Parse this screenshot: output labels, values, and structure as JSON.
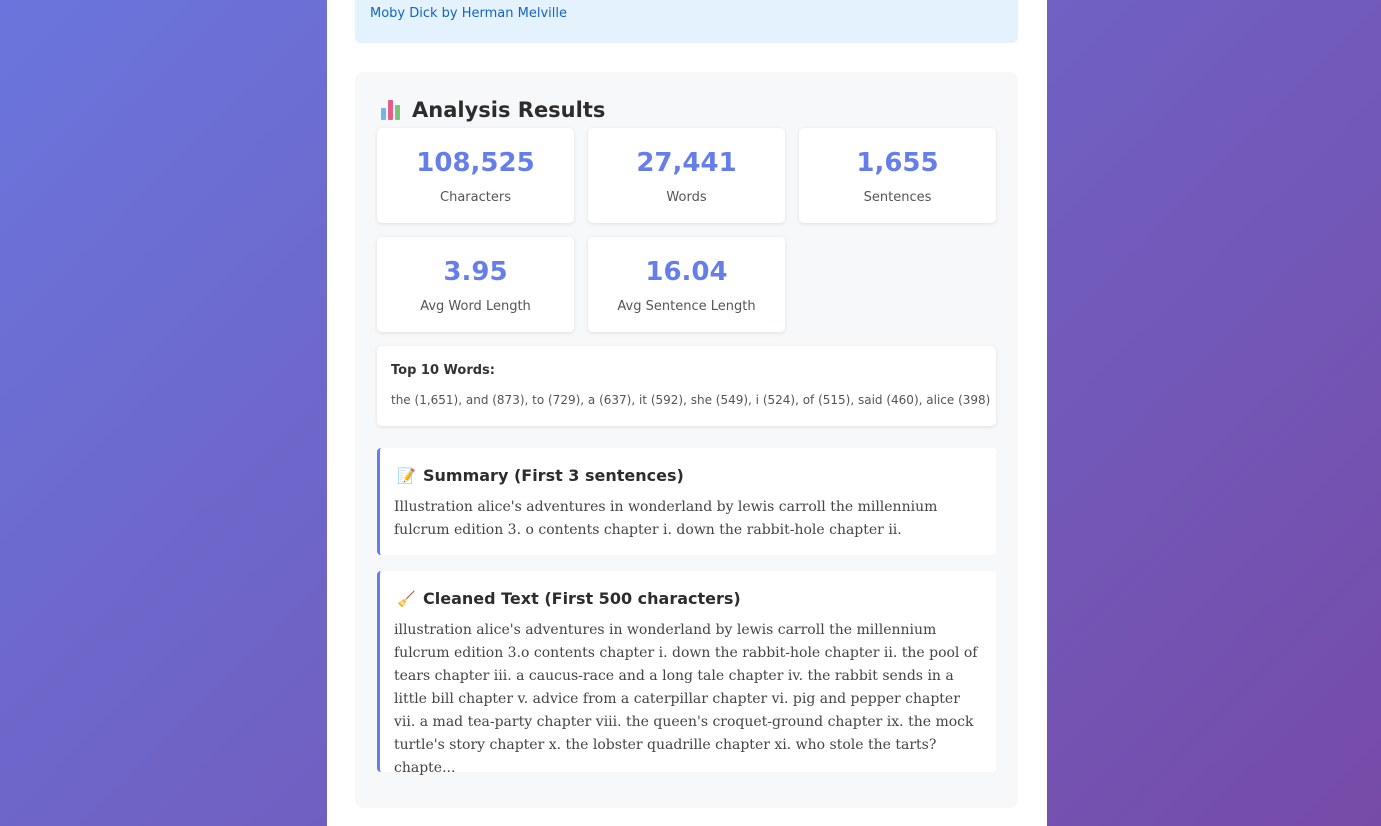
{
  "source": {
    "link_text": "Moby Dick by Herman Melville"
  },
  "results": {
    "title": "Analysis Results",
    "title_icon": "bar-chart-icon",
    "stats": [
      {
        "value": "108,525",
        "label": "Characters"
      },
      {
        "value": "27,441",
        "label": "Words"
      },
      {
        "value": "1,655",
        "label": "Sentences"
      },
      {
        "value": "3.95",
        "label": "Avg Word Length"
      },
      {
        "value": "16.04",
        "label": "Avg Sentence Length"
      }
    ],
    "top_words": {
      "title": "Top 10 Words:",
      "list": "the (1,651), and (873), to (729), a (637), it (592), she (549), i (524), of (515), said (460), alice (398)"
    },
    "summary": {
      "icon": "memo-icon",
      "heading": "Summary (First 3 sentences)",
      "text": "Illustration alice's adventures in wonderland by lewis carroll the millennium fulcrum edition 3. o contents chapter i. down the rabbit-hole chapter ii."
    },
    "cleaned": {
      "icon": "broom-icon",
      "heading": "Cleaned Text (First 500 characters)",
      "text": "illustration alice's adventures in wonderland by lewis carroll the millennium fulcrum edition 3.o contents chapter i. down the rabbit-hole chapter ii. the pool of tears chapter iii. a caucus-race and a long tale chapter iv. the rabbit sends in a little bill chapter v. advice from a caterpillar chapter vi. pig and pepper chapter vii. a mad tea-party chapter viii. the queen's croquet-ground chapter ix. the mock turtle's story chapter x. the lobster quadrille chapter xi. who stole the tarts? chapte..."
    }
  },
  "colors": {
    "accent": "#667eea",
    "background_start": "#6a75dc",
    "background_end": "#764ba8",
    "link": "#1565c0"
  }
}
